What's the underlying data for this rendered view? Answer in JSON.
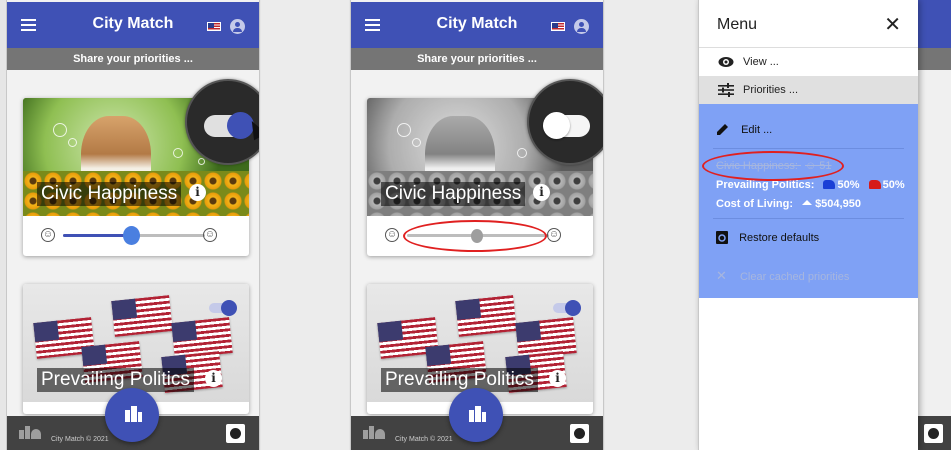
{
  "app": {
    "title": "City Match",
    "subtitle": "Share your priorities ...",
    "copyright": "City Match © 2021"
  },
  "cards": {
    "happiness": {
      "title": "Civic Happiness",
      "info": "i"
    },
    "politics": {
      "title": "Prevailing Politics",
      "info": "i"
    }
  },
  "panels": [
    {
      "toggle_on": true,
      "slider_value": 0.48,
      "photo_color": true
    },
    {
      "toggle_on": false,
      "slider_value": 0.5,
      "photo_color": false
    }
  ],
  "menu": {
    "title": "Menu",
    "close": "✕",
    "items": [
      {
        "label": "View ...",
        "icon": "eye-icon"
      },
      {
        "label": "Priorities ...",
        "icon": "tune-icon"
      }
    ],
    "edit": "Edit ...",
    "summary": {
      "happiness_label": "Civic Happiness:",
      "happiness_value": "☺ 51",
      "politics_label": "Prevailing Politics:",
      "dem_pct": "50%",
      "rep_pct": "50%",
      "cost_label": "Cost of Living:",
      "cost_value": "$504,950"
    },
    "restore": "Restore defaults",
    "clear": "Clear cached priorities"
  },
  "colors": {
    "primary": "#3f51b5",
    "subbar": "#757575",
    "footer": "#424242",
    "menu_panel": "#7fa1f5",
    "highlight": "#e02020"
  }
}
